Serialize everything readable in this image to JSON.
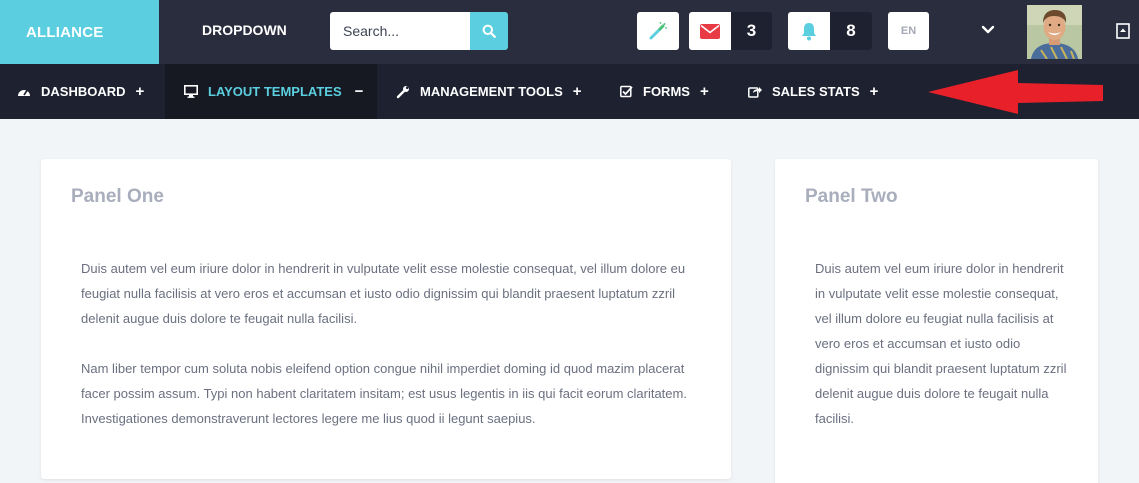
{
  "header": {
    "brand": "ALLIANCE",
    "dropdown_label": "DROPDOWN",
    "search_placeholder": "Search...",
    "mail_count": "3",
    "notification_count": "8",
    "language": "EN"
  },
  "colors": {
    "accent": "#5bcfe0",
    "header_bg": "#2a2d3e",
    "nav_bg": "#1e2130",
    "mail_icon": "#e83a45",
    "arrow": "#e8202a"
  },
  "icons": [
    "magic-wand-icon",
    "mail-icon",
    "bell-icon",
    "chevron-down-icon",
    "fullscreen-icon",
    "search-icon"
  ],
  "nav": {
    "items": [
      {
        "label": "DASHBOARD",
        "icon": "dashboard-icon",
        "sign": "+"
      },
      {
        "label": "LAYOUT TEMPLATES",
        "icon": "monitor-icon",
        "sign": "−",
        "active": true
      },
      {
        "label": "MANAGEMENT TOOLS",
        "icon": "wrench-icon",
        "sign": "+"
      },
      {
        "label": "FORMS",
        "icon": "checkbox-icon",
        "sign": "+"
      },
      {
        "label": "SALES STATS",
        "icon": "share-icon",
        "sign": "+"
      }
    ]
  },
  "panels": {
    "one": {
      "title": "Panel One",
      "paragraph1": "Duis autem vel eum iriure dolor in hendrerit in vulputate velit esse molestie consequat, vel illum dolore eu feugiat nulla facilisis at vero eros et accumsan et iusto odio dignissim qui blandit praesent luptatum zzril delenit augue duis dolore te feugait nulla facilisi.",
      "paragraph2": "Nam liber tempor cum soluta nobis eleifend option congue nihil imperdiet doming id quod mazim placerat facer possim assum. Typi non habent claritatem insitam; est usus legentis in iis qui facit eorum claritatem. Investigationes demonstraverunt lectores legere me lius quod ii legunt saepius."
    },
    "two": {
      "title": "Panel Two",
      "paragraph1": "Duis autem vel eum iriure dolor in hendrerit in vulputate velit esse molestie consequat, vel illum dolore eu feugiat nulla facilisis at vero eros et accumsan et iusto odio dignissim qui blandit praesent luptatum zzril delenit augue duis dolore te feugait nulla facilisi."
    }
  }
}
